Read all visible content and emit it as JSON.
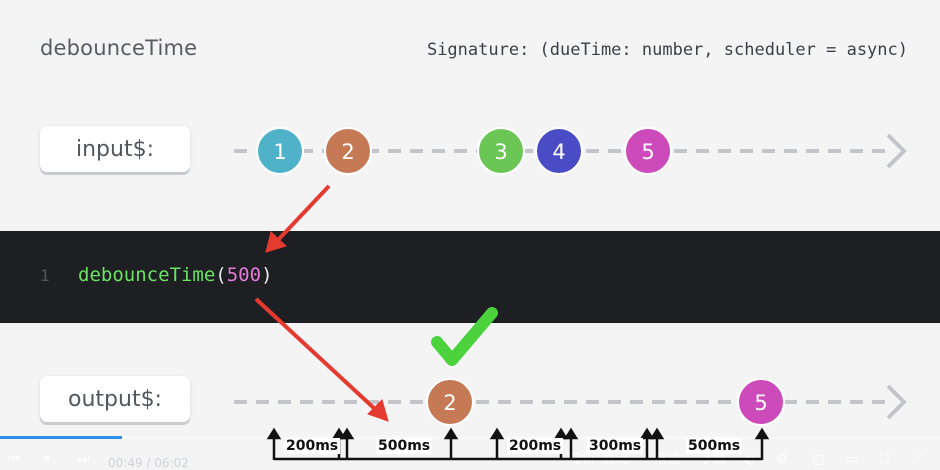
{
  "header": {
    "title": "debounceTime",
    "signature": "Signature: (dueTime: number, scheduler = async)"
  },
  "input_lane": {
    "label": "input$:",
    "marbles": [
      {
        "value": "1",
        "color": "#4fb2c9"
      },
      {
        "value": "2",
        "color": "#c57a55"
      },
      {
        "value": "3",
        "color": "#6cc655"
      },
      {
        "value": "4",
        "color": "#4a4cc6"
      },
      {
        "value": "5",
        "color": "#cc4aba"
      }
    ]
  },
  "code": {
    "line_number": "1",
    "function_name": "debounceTime",
    "open_paren": "(",
    "argument": "500",
    "close_paren": ")"
  },
  "output_lane": {
    "label": "output$:",
    "marbles": [
      {
        "value": "2",
        "color": "#c57a55"
      },
      {
        "value": "5",
        "color": "#cc4aba"
      }
    ]
  },
  "timing": {
    "labels": [
      "200ms",
      "500ms",
      "200ms",
      "300ms",
      "500ms"
    ]
  },
  "player": {
    "current_time": "00:49",
    "separator": "/",
    "duration": "06:02",
    "progress": 0.13,
    "quality": "720P 高清",
    "speed": "倍速",
    "subtitle": "字幕"
  },
  "colors": {
    "background": "#f4f4f5",
    "code_bg": "#1e1f23",
    "arrow_red": "#e53a2f",
    "check_green": "#4bd23d",
    "dash_gray": "#c3c5cb",
    "progress_blue": "#2e8fe8"
  }
}
